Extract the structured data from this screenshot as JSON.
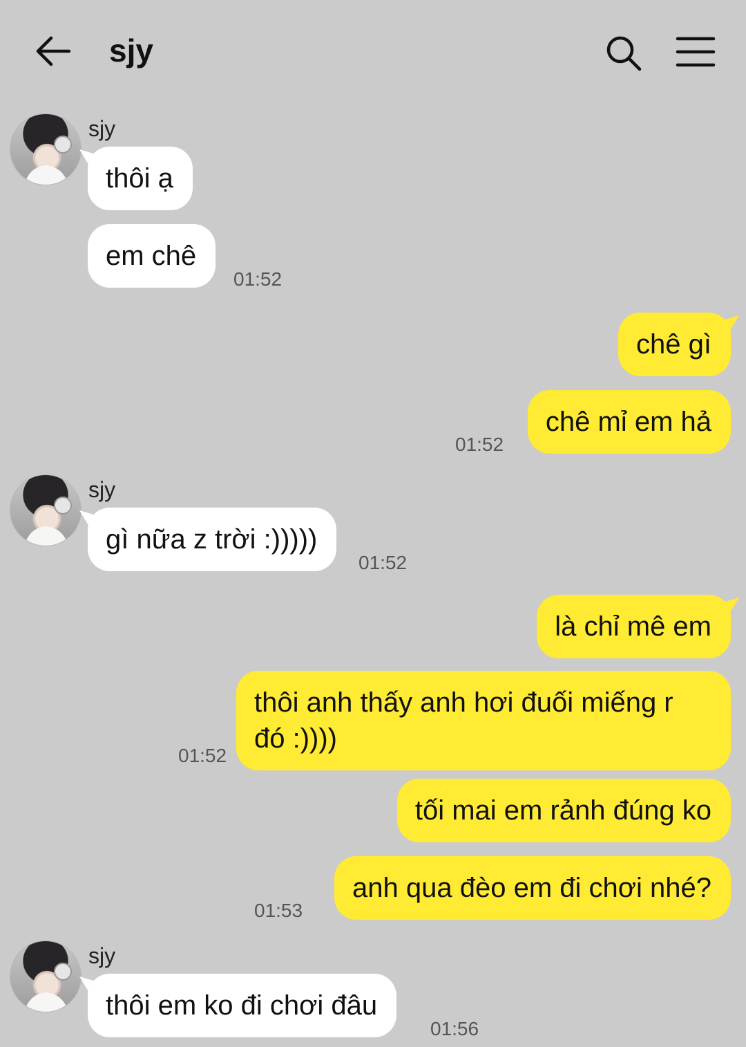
{
  "header": {
    "back_icon": "arrow-left-icon",
    "title": "sjy",
    "search_icon": "search-icon",
    "menu_icon": "hamburger-menu-icon"
  },
  "colors": {
    "background": "#cbcbcb",
    "incoming_bubble": "#ffffff",
    "outgoing_bubble": "#ffeb33",
    "timestamp": "#555555"
  },
  "messages": [
    {
      "sender": "sjy",
      "direction": "in",
      "text": "thôi ạ"
    },
    {
      "direction": "in",
      "text": "em chê",
      "time": "01:52"
    },
    {
      "direction": "out",
      "text": "chê gì"
    },
    {
      "direction": "out",
      "text": "chê mỉ em hả",
      "time": "01:52"
    },
    {
      "sender": "sjy",
      "direction": "in",
      "text": "gì nữa z trời :)))))",
      "time": "01:52"
    },
    {
      "direction": "out",
      "text": "là chỉ mê em"
    },
    {
      "direction": "out",
      "text": "thôi anh thấy anh hơi đuối miếng r đó :))))",
      "time": "01:52"
    },
    {
      "direction": "out",
      "text": "tối mai em rảnh đúng ko"
    },
    {
      "direction": "out",
      "text": "anh qua đèo em đi chơi nhé?",
      "time": "01:53"
    },
    {
      "sender": "sjy",
      "direction": "in",
      "text": "thôi em ko đi chơi đâu",
      "time": "01:56"
    }
  ]
}
